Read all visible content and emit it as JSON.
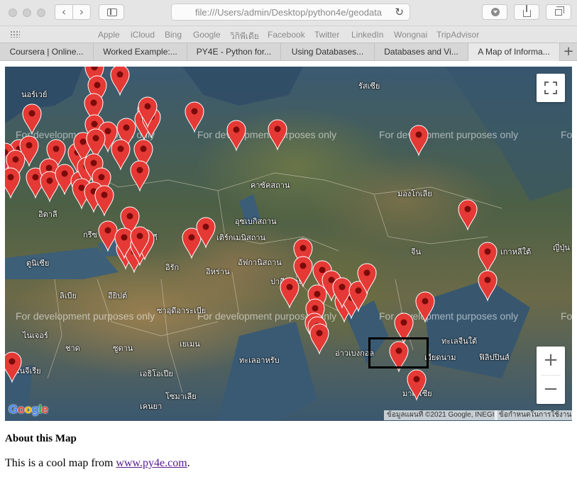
{
  "browser": {
    "url": "file:///Users/admin/Desktop/python4e/geodata",
    "favorites": [
      "Apple",
      "iCloud",
      "Bing",
      "Google",
      "วิกิพีเดีย",
      "Facebook",
      "Twitter",
      "LinkedIn",
      "Wongnai",
      "TripAdvisor"
    ],
    "tabs": [
      {
        "label": "Coursera | Online...",
        "active": false
      },
      {
        "label": "Worked Example:...",
        "active": false
      },
      {
        "label": "PY4E - Python for...",
        "active": false
      },
      {
        "label": "Using Databases...",
        "active": false
      },
      {
        "label": "Databases and Vi...",
        "active": false
      },
      {
        "label": "A Map of Informa...",
        "active": true
      }
    ],
    "new_tab_label": "+"
  },
  "map": {
    "watermark": "For development purposes only",
    "labels": [
      "รัสเซีย",
      "นอร์เวย์",
      "คาซัคสถาน",
      "มองโกเลีย",
      "อิตาลี",
      "อุซเบกิสถาน",
      "เติร์กเมนิสถาน",
      "จีน",
      "เกาหลีใต้",
      "ญี่ปุ่น",
      "อัฟกานิสถาน",
      "อิหร่าน",
      "อิรัก",
      "ตูนิเซีย",
      "ลิเบีย",
      "อียิปต์",
      "ซาอุดีอาระเบีย",
      "ปากีสถาน",
      "ไนเจอร์",
      "ชาด",
      "ซูดาน",
      "เยเมน",
      "เวียดนาม",
      "ฟิลิปปินส์",
      "เอธิโอเปีย",
      "โซมาเลีย",
      "เคนยา",
      "ไนจีเรีย",
      "มาเลเซีย",
      "ทะเลอาหรับ",
      "อ่าวเบงกอล",
      "ทะเลจีนใต้",
      "กรีซ",
      "ตุรกี"
    ],
    "google_logo": "Google",
    "attribution": "ข้อมูลแผนที่ ©2021 Google, INEGI",
    "terms": "ข้อกำหนดในการใช้งาน",
    "zoom_in": "+",
    "zoom_out": "−"
  },
  "page": {
    "heading": "About this Map",
    "text_before": "This is a cool map from ",
    "link_text": "www.py4e.com",
    "text_after": "."
  },
  "colors": {
    "pin": "#e53935",
    "pin_dot": "#7a0b0b",
    "link": "#551a8b"
  }
}
